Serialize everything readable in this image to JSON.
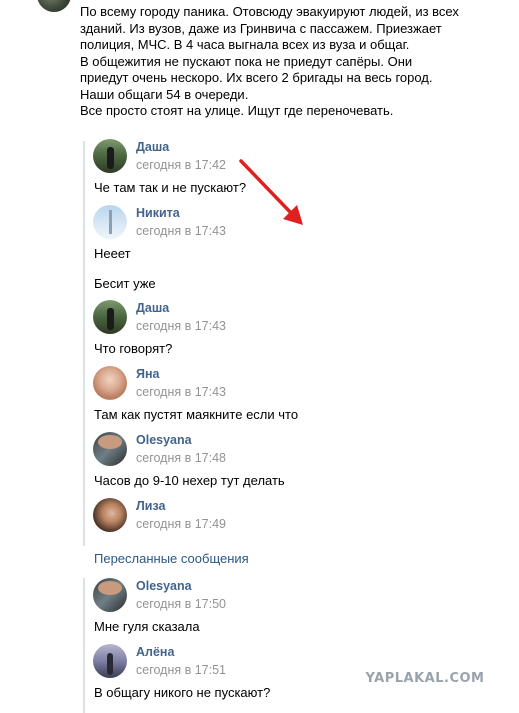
{
  "post": {
    "lines": [
      "По всему городу паника. Отовсюду эвакуируют людей, из всех",
      "зданий. Из вузов, даже из Гринвича с пассажем. Приезжает",
      "полиция, МЧС. В 4 часа выгнала всех из вуза и общаг.",
      "В общежития не пускают пока не приедут сапёры. Они",
      "приедут очень нескоро. Их всего 2 бригады на весь город.",
      "Наши общаги 54 в очереди.",
      "Все просто стоят на улице. Ищут где переночевать."
    ]
  },
  "messages": [
    {
      "name": "Даша",
      "time": "сегодня в 17:42",
      "text": "Че там так и не пускают?",
      "text2": ""
    },
    {
      "name": "Никита",
      "time": "сегодня в 17:43",
      "text": "Нееет",
      "text2": "Бесит уже"
    },
    {
      "name": "Даша",
      "time": "сегодня в 17:43",
      "text": "Что говорят?",
      "text2": ""
    },
    {
      "name": "Яна",
      "time": "сегодня в 17:43",
      "text": "Там как пустят маякните если что",
      "text2": ""
    },
    {
      "name": "Olesyana",
      "time": "сегодня в 17:48",
      "text": "Часов до 9-10 нехер тут делать",
      "text2": ""
    },
    {
      "name": "Лиза",
      "time": "сегодня в 17:49",
      "text": "",
      "text2": ""
    }
  ],
  "forwarded": {
    "title": "Пересланные сообщения",
    "messages": [
      {
        "name": "Olesyana",
        "time": "сегодня в 17:50",
        "text": "Мне гуля сказала"
      },
      {
        "name": "Алёна",
        "time": "сегодня в 17:51",
        "text": "В общагу никого не пускают?"
      }
    ]
  },
  "watermark": "YAPLAKAL.COM",
  "colors": {
    "name": "#42648b",
    "time": "#939393",
    "link": "#2a5885",
    "arrow": "#e02020"
  }
}
